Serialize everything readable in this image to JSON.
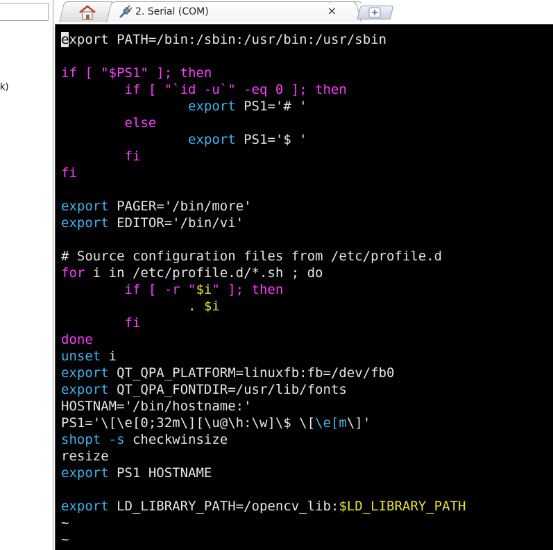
{
  "left_pane": {
    "fragment_text": "k)"
  },
  "tabs": {
    "home": {
      "icon": "home-icon"
    },
    "serial": {
      "title": "2. Serial (COM)",
      "icon": "plug-icon",
      "close": "×"
    },
    "new": {
      "icon": "plus-icon"
    }
  },
  "colors": {
    "keyword": "#ff3dff",
    "builtin": "#3fb4ee",
    "variable": "#e8e23a",
    "text": "#e6e6e6",
    "background": "#000000"
  },
  "terminal": {
    "lines": [
      [
        [
          "cursor",
          "e"
        ],
        [
          "white",
          "xport PATH=/bin:/sbin:/usr/bin:/usr/sbin"
        ]
      ],
      [],
      [
        [
          "magenta",
          "if [ \"$PS1\" ]; then"
        ]
      ],
      [
        [
          "white",
          "        "
        ],
        [
          "magenta",
          "if [ \"`id -u`\" -eq 0 ]; then"
        ]
      ],
      [
        [
          "white",
          "                "
        ],
        [
          "cyan",
          "export"
        ],
        [
          "white",
          " PS1='# '"
        ]
      ],
      [
        [
          "white",
          "        "
        ],
        [
          "magenta",
          "else"
        ]
      ],
      [
        [
          "white",
          "                "
        ],
        [
          "cyan",
          "export"
        ],
        [
          "white",
          " PS1='$ '"
        ]
      ],
      [
        [
          "white",
          "        "
        ],
        [
          "magenta",
          "fi"
        ]
      ],
      [
        [
          "magenta",
          "fi"
        ]
      ],
      [],
      [
        [
          "cyan",
          "export"
        ],
        [
          "white",
          " PAGER='/bin/more'"
        ]
      ],
      [
        [
          "cyan",
          "export"
        ],
        [
          "white",
          " EDITOR='/bin/vi'"
        ]
      ],
      [],
      [
        [
          "white",
          "# Source configuration files from /etc/profile.d"
        ]
      ],
      [
        [
          "magenta",
          "for"
        ],
        [
          "white",
          " i in /etc/profile.d/*.sh ; do"
        ]
      ],
      [
        [
          "white",
          "        "
        ],
        [
          "magenta",
          "if [ -r \""
        ],
        [
          "yellow",
          "$i"
        ],
        [
          "magenta",
          "\" ]; then"
        ]
      ],
      [
        [
          "white",
          "                . "
        ],
        [
          "yellow",
          "$i"
        ]
      ],
      [
        [
          "white",
          "        "
        ],
        [
          "magenta",
          "fi"
        ]
      ],
      [
        [
          "magenta",
          "done"
        ]
      ],
      [
        [
          "cyan",
          "unset"
        ],
        [
          "white",
          " i"
        ]
      ],
      [
        [
          "cyan",
          "export"
        ],
        [
          "white",
          " QT_QPA_PLATFORM=linuxfb:fb=/dev/fb0"
        ]
      ],
      [
        [
          "cyan",
          "export"
        ],
        [
          "white",
          " QT_QPA_FONTDIR=/usr/lib/fonts"
        ]
      ],
      [
        [
          "white",
          "HOSTNAM='/bin/hostname:'"
        ]
      ],
      [
        [
          "white",
          "PS1='\\[\\e[0;32m\\][\\u@\\h:\\w]\\$ \\["
        ],
        [
          "cyan",
          "\\e[m"
        ],
        [
          "white",
          "\\]'"
        ]
      ],
      [
        [
          "cyan",
          "shopt -s"
        ],
        [
          "white",
          " checkwinsize"
        ]
      ],
      [
        [
          "white",
          "resize"
        ]
      ],
      [
        [
          "cyan",
          "export"
        ],
        [
          "white",
          " PS1 HOSTNAME"
        ]
      ],
      [],
      [
        [
          "cyan",
          "export"
        ],
        [
          "white",
          " LD_LIBRARY_PATH=/opencv_lib:"
        ],
        [
          "yellow",
          "$LD_LIBRARY_PATH"
        ]
      ],
      [
        [
          "white",
          "~"
        ]
      ],
      [
        [
          "white",
          "~"
        ]
      ]
    ]
  }
}
